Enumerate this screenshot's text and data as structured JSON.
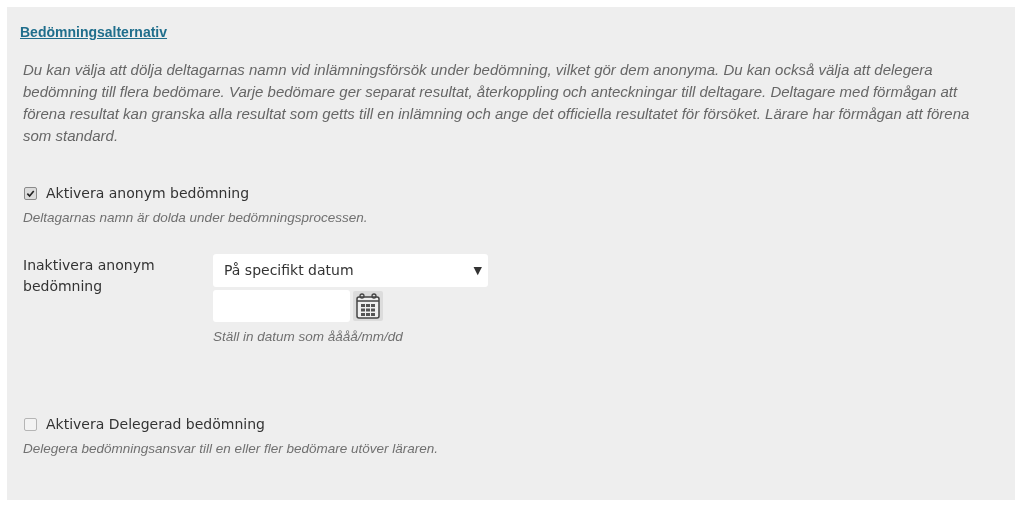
{
  "heading": "Bedömningsalternativ",
  "description": "Du kan välja att dölja deltagarnas namn vid inlämningsförsök under bedömning, vilket gör dem anonyma. Du kan också välja att delegera bedömning till flera bedömare. Varje bedömare ger separat resultat, återkoppling och anteckningar till deltagare. Deltagare med förmågan att förena resultat kan granska alla resultat som getts till en inlämning och ange det officiella resultatet för försöket. Lärare har förmågan att förena som standard.",
  "anonymous": {
    "label": "Aktivera anonym bedömning",
    "checked": true,
    "help": "Deltagarnas namn är dolda under bedömningsprocessen."
  },
  "disable_anonymous": {
    "label": "Inaktivera anonym bedömning",
    "select_value": "På specifikt datum",
    "select_caret": "▼",
    "date_help": "Ställ in datum som åååå/mm/dd"
  },
  "delegated": {
    "label": "Aktivera Delegerad bedömning",
    "checked": false,
    "help": "Delegera bedömningsansvar till en eller fler bedömare utöver läraren."
  }
}
